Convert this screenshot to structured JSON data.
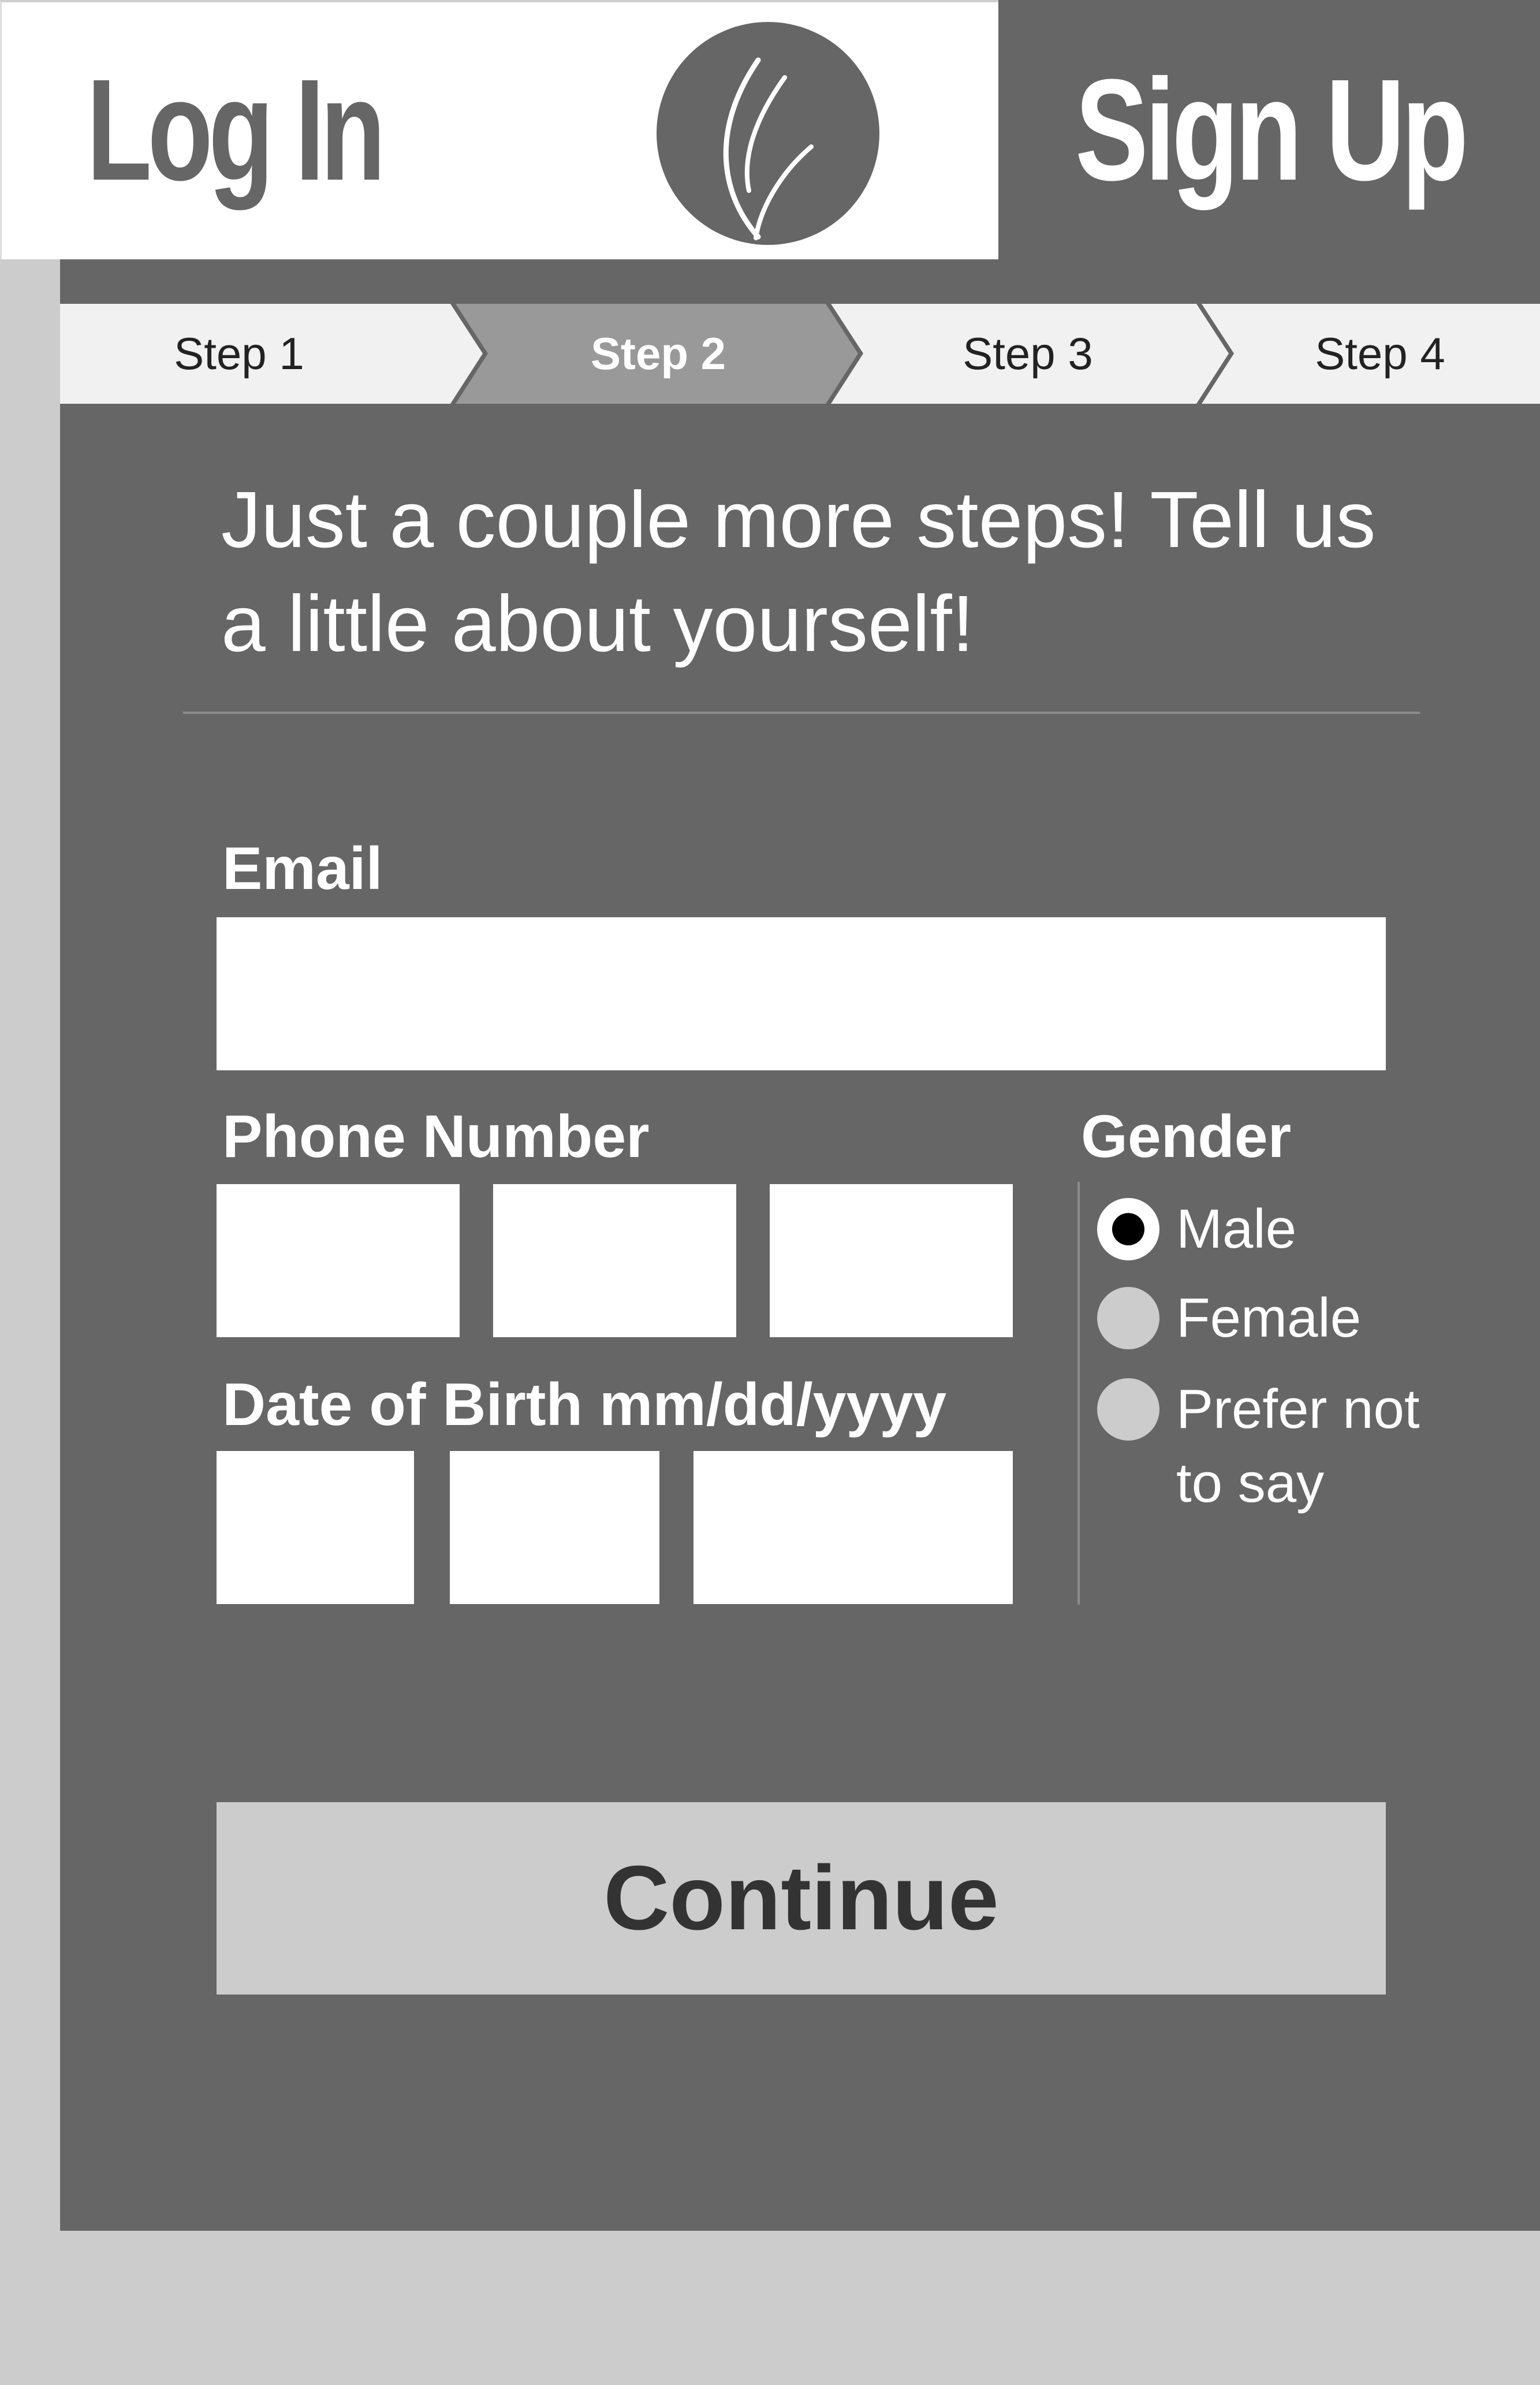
{
  "header": {
    "login_label": "Log In",
    "signup_label": "Sign Up",
    "logo_icon": "leaf-logo-icon"
  },
  "steps": [
    {
      "label": "Step 1",
      "active": false
    },
    {
      "label": "Step 2",
      "active": true
    },
    {
      "label": "Step 3",
      "active": false
    },
    {
      "label": "Step 4",
      "active": false
    }
  ],
  "form": {
    "heading_line1": "Just a couple more steps! Tell us",
    "heading_line2": "a little about yourself!",
    "email_label": "Email",
    "email_value": "",
    "phone_label": "Phone Number",
    "phone_values": [
      "",
      "",
      ""
    ],
    "dob_label": "Date of Birth mm/dd/yyyy",
    "dob_values": [
      "",
      "",
      ""
    ],
    "gender_label": "Gender",
    "gender_options": [
      {
        "label": "Male",
        "selected": true
      },
      {
        "label": "Female",
        "selected": false
      },
      {
        "label_line1": "Prefer not",
        "label_line2": "to say",
        "selected": false
      }
    ],
    "continue_label": "Continue"
  },
  "colors": {
    "page_background": "#cccccc",
    "panel": "#666666",
    "header_active": "#ffffff",
    "step_inactive": "#f0f1f0",
    "step_active": "#999999",
    "button": "#cccccc",
    "button_text": "#333333"
  }
}
